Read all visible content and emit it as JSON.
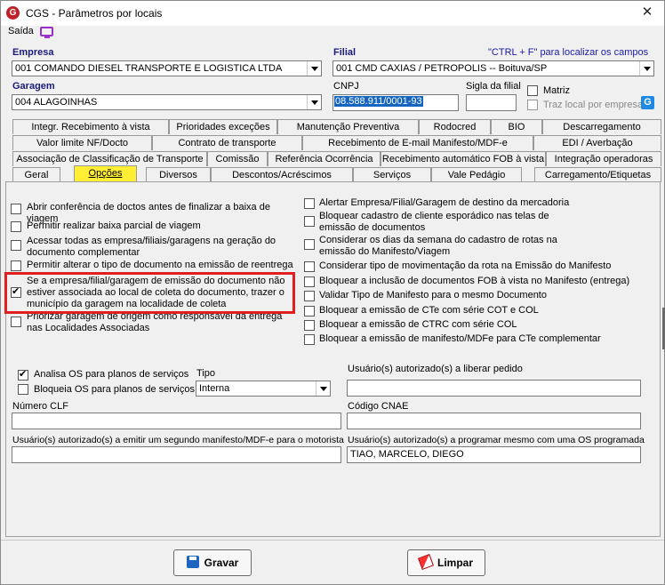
{
  "window": {
    "title": "CGS - Parâmetros por locais",
    "close": "✕"
  },
  "menu": {
    "saida": "Saída"
  },
  "header": {
    "empresa_label": "Empresa",
    "empresa_value": "001 COMANDO DIESEL TRANSPORTE E LOGISTICA LTDA",
    "filial_label": "Filial",
    "filial_hint": "\"CTRL + F\" para localizar os campos",
    "filial_value": "001 CMD CAXIAS / PETROPOLIS -- Boituva/SP",
    "garagem_label": "Garagem",
    "garagem_value": "004 ALAGOINHAS",
    "cnpj_label": "CNPJ",
    "cnpj_value": "08.588.911/0001-93",
    "sigla_label": "Sigla da filial",
    "sigla_value": "",
    "matriz_label": "Matriz",
    "traz_local_label": "Traz local por empresa",
    "g_icon": "G"
  },
  "tabs": {
    "row1": [
      "Integr. Recebimento à vista",
      "Prioridades exceções",
      "Manutenção Preventiva",
      "Rodocred",
      "BIO",
      "Descarregamento"
    ],
    "row2": [
      "Valor limite NF/Docto",
      "Contrato de transporte",
      "Recebimento de E-mail Manifesto/MDF-e",
      "EDI / Averbação"
    ],
    "row3": [
      "Associação de Classificação de Transporte",
      "Comissão",
      "Referência Ocorrência",
      "Recebimento automático FOB à vista",
      "Integração operadoras"
    ],
    "row4": [
      "Geral",
      "Opções",
      "Diversos",
      "Descontos/Acréscimos",
      "Serviços",
      "Vale Pedágio",
      "Carregamento/Etiquetas"
    ]
  },
  "options_left": [
    {
      "label": "Abrir conferência de doctos antes de finalizar a baixa de viagem",
      "checked": false
    },
    {
      "label": "Permitir realizar baixa parcial de viagem",
      "checked": false
    },
    {
      "label": "Acessar todas as empresa/filiais/garagens na geração do documento complementar",
      "checked": false
    },
    {
      "label": "Permitir alterar o tipo de documento na emissão de reentrega",
      "checked": false
    },
    {
      "label": "Se a empresa/filial/garagem de emissão do documento não estiver associada ao local de coleta do documento, trazer o município da garagem na localidade de coleta",
      "checked": true
    },
    {
      "label": "Priorizar garagem de origem como responsável da entrega nas Localidades Associadas",
      "checked": false
    }
  ],
  "options_right": [
    {
      "label": "Alertar Empresa/Filial/Garagem de destino da mercadoria",
      "checked": false
    },
    {
      "label": "Bloquear cadastro de cliente esporádico nas telas de emissão de documentos",
      "checked": false
    },
    {
      "label": "Considerar os dias da semana do cadastro de rotas na emissão do Manifesto/Viagem",
      "checked": false
    },
    {
      "label": "Considerar tipo de movimentação da rota na Emissão do Manifesto",
      "checked": false
    },
    {
      "label": "Bloquear a inclusão de documentos FOB à vista no Manifesto (entrega)",
      "checked": false
    },
    {
      "label": "Validar Tipo de Manifesto para o mesmo Documento",
      "checked": false
    },
    {
      "label": "Bloquear a emissão de CTe com série COT e COL",
      "checked": false
    },
    {
      "label": "Bloquear a emissão de CTRC com série COL",
      "checked": false
    },
    {
      "label": "Bloquear a emissão de manifesto/MDFe para CTe complementar",
      "checked": false
    }
  ],
  "os": {
    "analisa_label": "Analisa OS para planos de serviços",
    "bloqueia_label": "Bloqueia OS para planos de serviços",
    "tipo_label": "Tipo",
    "tipo_value": "Interna",
    "usuarios_liberar_label": "Usuário(s) autorizado(s) a liberar pedido",
    "usuarios_liberar_value": ""
  },
  "fields": {
    "numero_clf_label": "Número CLF",
    "numero_clf_value": "",
    "cnae_label": "Código CNAE",
    "cnae_value": "",
    "segundo_manifesto_label": "Usuário(s) autorizado(s) a emitir um segundo manifesto/MDF-e para o motorista",
    "segundo_manifesto_value": "",
    "programar_os_label": "Usuário(s) autorizado(s) a programar mesmo com uma OS programada",
    "programar_os_value": "TIAO, MARCELO, DIEGO"
  },
  "buttons": {
    "gravar": "Gravar",
    "limpar": "Limpar"
  }
}
